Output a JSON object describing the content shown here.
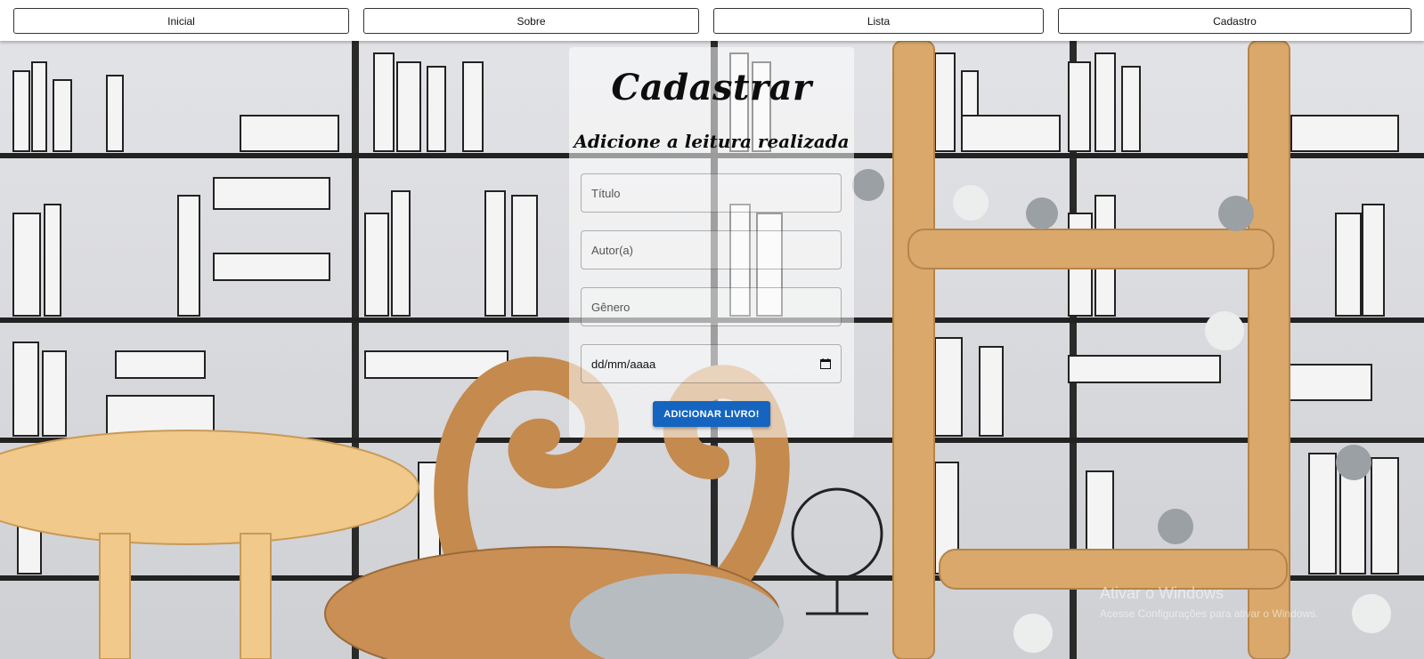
{
  "nav": {
    "items": [
      {
        "label": "Inicial"
      },
      {
        "label": "Sobre"
      },
      {
        "label": "Lista"
      },
      {
        "label": "Cadastro"
      }
    ]
  },
  "form": {
    "title": "Cadastrar",
    "subtitle": "Adicione a leitura realizada",
    "fields": {
      "titulo": {
        "placeholder": "Título",
        "value": ""
      },
      "autor": {
        "placeholder": "Autor(a)",
        "value": ""
      },
      "genero": {
        "placeholder": "Gênero",
        "value": ""
      },
      "data": {
        "display": "dd/mm/aaaa"
      }
    },
    "submit_label": "ADICIONAR LIVRO!"
  },
  "watermark": {
    "title": "Ativar o Windows",
    "subtitle": "Acesse Configurações para ativar o Windows."
  },
  "colors": {
    "primary_button": "#1565c0",
    "nav_background": "#ffffff"
  }
}
